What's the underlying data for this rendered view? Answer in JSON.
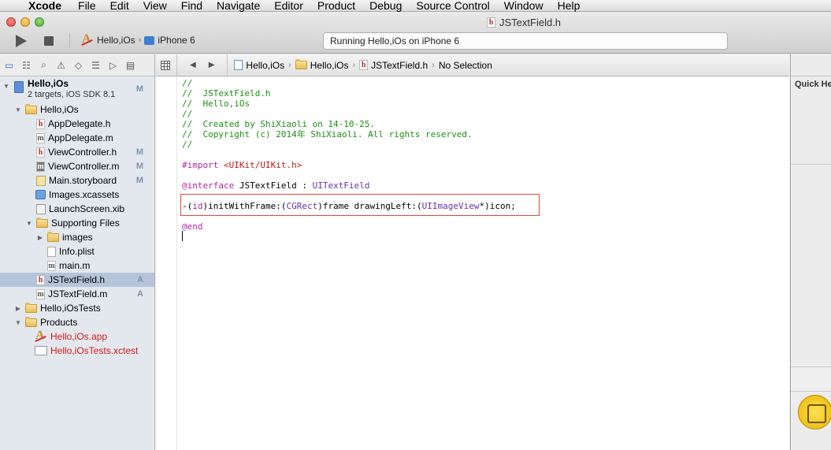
{
  "menu": {
    "apple": "",
    "items": [
      "Xcode",
      "File",
      "Edit",
      "View",
      "Find",
      "Navigate",
      "Editor",
      "Product",
      "Debug",
      "Source Control",
      "Window",
      "Help"
    ]
  },
  "window": {
    "title": "JSTextField.h"
  },
  "toolbar": {
    "scheme": "Hello,iOs",
    "device": "iPhone 6",
    "activity": "Running Hello,iOs on iPhone 6"
  },
  "navigator": {
    "project": {
      "name": "Hello,iOs",
      "subtitle": "2 targets, iOS SDK 8.1",
      "badge": "M"
    },
    "items": [
      {
        "label": "Hello,iOs",
        "badge": ""
      },
      {
        "label": "AppDelegate.h",
        "badge": ""
      },
      {
        "label": "AppDelegate.m",
        "badge": ""
      },
      {
        "label": "ViewController.h",
        "badge": "M"
      },
      {
        "label": "ViewController.m",
        "badge": "M"
      },
      {
        "label": "Main.storyboard",
        "badge": "M"
      },
      {
        "label": "Images.xcassets",
        "badge": ""
      },
      {
        "label": "LaunchScreen.xib",
        "badge": ""
      },
      {
        "label": "Supporting Files",
        "badge": ""
      },
      {
        "label": "images",
        "badge": ""
      },
      {
        "label": "Info.plist",
        "badge": ""
      },
      {
        "label": "main.m",
        "badge": ""
      },
      {
        "label": "JSTextField.h",
        "badge": "A"
      },
      {
        "label": "JSTextField.m",
        "badge": "A"
      },
      {
        "label": "Hello,iOsTests",
        "badge": ""
      },
      {
        "label": "Products",
        "badge": ""
      },
      {
        "label": "Hello,iOs.app",
        "badge": ""
      },
      {
        "label": "Hello,iOsTests.xctest",
        "badge": ""
      }
    ]
  },
  "jumpbar": {
    "crumbs": [
      "Hello,iOs",
      "Hello,iOs",
      "JSTextField.h",
      "No Selection"
    ]
  },
  "editor": {
    "lines": {
      "l1": "//",
      "l2": "//  JSTextField.h",
      "l3": "//  Hello,iOs",
      "l4": "//",
      "l5": "//  Created by ShiXiaoli on 14-10-25.",
      "l6": "//  Copyright (c) 2014年 ShiXiaoli. All rights reserved.",
      "l7": "//",
      "import_kw": "#import",
      "import_path": " <UIKit/UIKit.h>",
      "interface_kw": "@interface",
      "interface_name": " JSTextField : ",
      "interface_super": "UITextField",
      "m_dash": "-(",
      "m_id": "id",
      "m_mid": ")initWithFrame:(",
      "m_type1": "CGRect",
      "m_mid2": ")frame drawingLeft:(",
      "m_type2": "UIImageView",
      "m_end": "*)icon;",
      "end_kw": "@end"
    }
  },
  "utilities": {
    "quick_help": "Quick He"
  }
}
